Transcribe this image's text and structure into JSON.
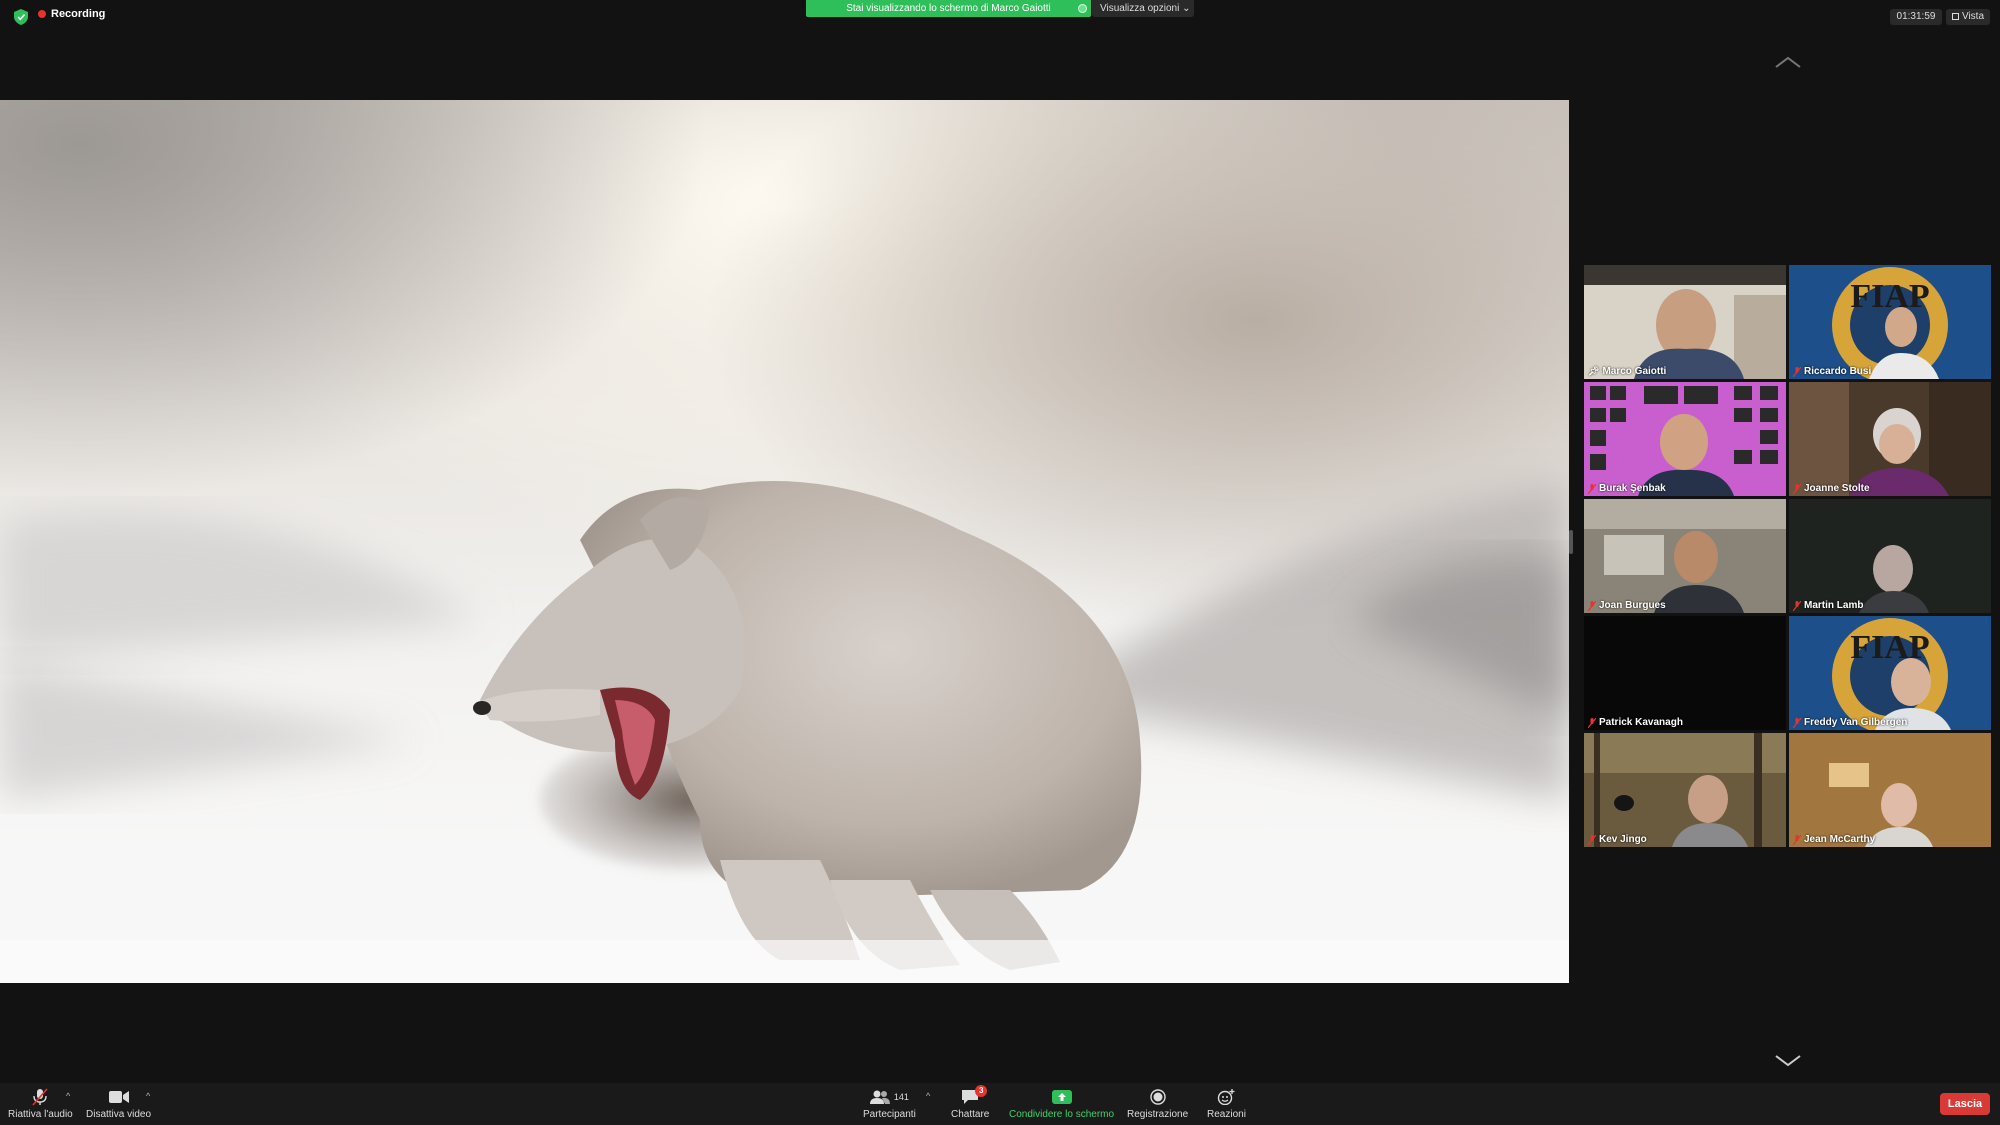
{
  "top_bar": {
    "recording_label": "Recording",
    "share_banner_text": "Stai visualizzando lo schermo di Marco Gaiotti",
    "view_options_label": "Visualizza opzioni",
    "elapsed_time": "01:31:59",
    "view_label": "Vista"
  },
  "colors": {
    "background": "#121212",
    "share_green": "#2fbf5a",
    "recording_red": "#e8322d",
    "active_speaker_border": "#e6e36a",
    "leave_red": "#d93a35",
    "toolbar_green": "#3ad36b"
  },
  "shared_screen": {
    "content": "arctic-fox-photo"
  },
  "gallery": {
    "participants": [
      {
        "name": "Marco Gaiotti",
        "active_speaker": true,
        "muted": false,
        "bg": "room"
      },
      {
        "name": "Riccardo Busi",
        "active_speaker": false,
        "muted": true,
        "bg": "fiap-logo"
      },
      {
        "name": "Burak Şenbak",
        "active_speaker": false,
        "muted": true,
        "bg": "magenta-wall"
      },
      {
        "name": "Joanne Stolte",
        "active_speaker": false,
        "muted": true,
        "bg": "shelves"
      },
      {
        "name": "Joan Burgues",
        "active_speaker": false,
        "muted": true,
        "bg": "office"
      },
      {
        "name": "Martin Lamb",
        "active_speaker": false,
        "muted": true,
        "bg": "dark"
      },
      {
        "name": "Patrick Kavanagh",
        "active_speaker": false,
        "muted": true,
        "bg": "black"
      },
      {
        "name": "Freddy Van Gilbergen",
        "active_speaker": false,
        "muted": true,
        "bg": "fiap-logo"
      },
      {
        "name": "Kev Jingo",
        "active_speaker": false,
        "muted": true,
        "bg": "forest"
      },
      {
        "name": "Jean McCarthy",
        "active_speaker": false,
        "muted": true,
        "bg": "warm-room"
      }
    ]
  },
  "toolbar": {
    "unmute_label": "Riattiva l'audio",
    "stop_video_label": "Disattiva video",
    "participants_label": "Partecipanti",
    "participants_count": "141",
    "chat_label": "Chattare",
    "chat_badge": "3",
    "share_label": "Condividere lo schermo",
    "record_label": "Registrazione",
    "reactions_label": "Reazioni",
    "leave_label": "Lascia"
  },
  "icons": [
    "shield-icon",
    "recording-dot-icon",
    "chevron-down-icon",
    "grid-view-icon",
    "chevron-up-icon",
    "microphone-muted-icon",
    "video-camera-icon",
    "participants-icon",
    "chat-icon",
    "share-screen-icon",
    "record-icon",
    "reactions-icon"
  ]
}
